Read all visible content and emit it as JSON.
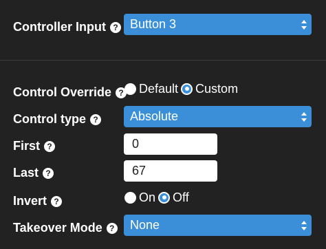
{
  "controller_input": {
    "label": "Controller Input",
    "value": "Button 3"
  },
  "control_override": {
    "label": "Control Override",
    "options": [
      "Default",
      "Custom"
    ],
    "selected": "Custom"
  },
  "control_type": {
    "label": "Control type",
    "value": "Absolute"
  },
  "first": {
    "label": "First",
    "value": "0"
  },
  "last": {
    "label": "Last",
    "value": "67"
  },
  "invert": {
    "label": "Invert",
    "options": [
      "On",
      "Off"
    ],
    "selected": "Off"
  },
  "takeover_mode": {
    "label": "Takeover Mode",
    "value": "None"
  },
  "help_glyph": "?",
  "colors": {
    "background": "#222222",
    "accent": "#3a8fd8",
    "text": "#ffffff"
  }
}
